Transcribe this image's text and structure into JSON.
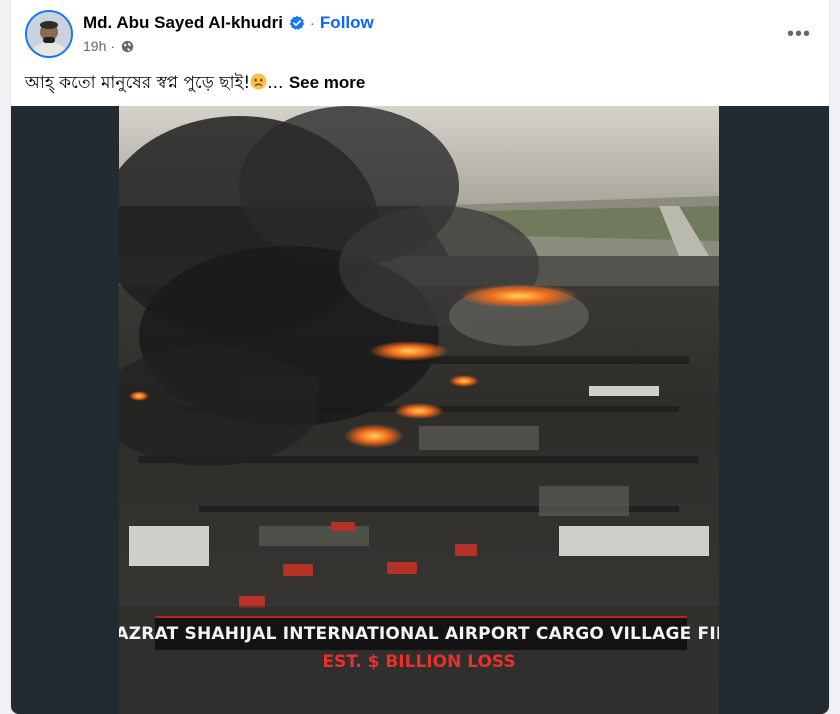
{
  "post": {
    "author": {
      "name": "Md. Abu Sayed Al-khudri",
      "verified": true,
      "avatar_icon": "avatar-portrait"
    },
    "follow_label": "Follow",
    "separator": "·",
    "timestamp": "19h",
    "privacy_icon": "globe-icon",
    "more_icon": "•••",
    "text": "আহ্ কতো মানুষের স্বপ্ন পুড়ে ছাই!",
    "text_emoji": "sad-face-emoji",
    "ellipsis": "...",
    "see_more_label": "See more"
  },
  "image": {
    "caption_title": "HAZRAT SHAHIJAL INTERNATIONAL AIRPORT CARGO VILLAGE FIRE",
    "caption_subtitle": "EST. $ BILLION LOSS"
  },
  "colors": {
    "link_blue": "#0866ff",
    "verified_blue": "#1877f2",
    "secondary_text": "#65676b",
    "caption_red": "#e8312a"
  }
}
